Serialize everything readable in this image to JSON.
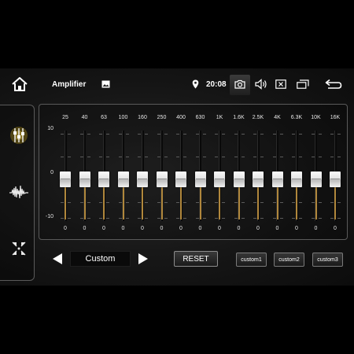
{
  "status_bar": {
    "title": "Amplifier",
    "time": "20:08",
    "icons": [
      "home-icon",
      "image-icon",
      "location-icon",
      "camera-icon",
      "volume-icon",
      "close-box-icon",
      "windows-icon",
      "back-icon"
    ]
  },
  "sidebar": {
    "items": [
      {
        "icon": "equalizer-sliders-icon",
        "active": true
      },
      {
        "icon": "waveform-icon",
        "active": false
      },
      {
        "icon": "balance-fader-icon",
        "active": false
      }
    ]
  },
  "equalizer": {
    "db_labels": {
      "top": "10",
      "mid": "0",
      "bottom": "-10"
    },
    "bands": [
      {
        "freq": "25",
        "value": "0"
      },
      {
        "freq": "40",
        "value": "0"
      },
      {
        "freq": "63",
        "value": "0"
      },
      {
        "freq": "100",
        "value": "0"
      },
      {
        "freq": "160",
        "value": "0"
      },
      {
        "freq": "250",
        "value": "0"
      },
      {
        "freq": "400",
        "value": "0"
      },
      {
        "freq": "630",
        "value": "0"
      },
      {
        "freq": "1K",
        "value": "0"
      },
      {
        "freq": "1.6K",
        "value": "0"
      },
      {
        "freq": "2.5K",
        "value": "0"
      },
      {
        "freq": "4K",
        "value": "0"
      },
      {
        "freq": "6.3K",
        "value": "0"
      },
      {
        "freq": "10K",
        "value": "0"
      },
      {
        "freq": "16K",
        "value": "0"
      }
    ]
  },
  "controls": {
    "preset": "Custom",
    "reset_label": "RESET",
    "custom_buttons": [
      "custom1",
      "custom2",
      "custom3"
    ]
  },
  "colors": {
    "accent": "#f0c419",
    "fill": "#b0873c",
    "background": "#141414"
  }
}
